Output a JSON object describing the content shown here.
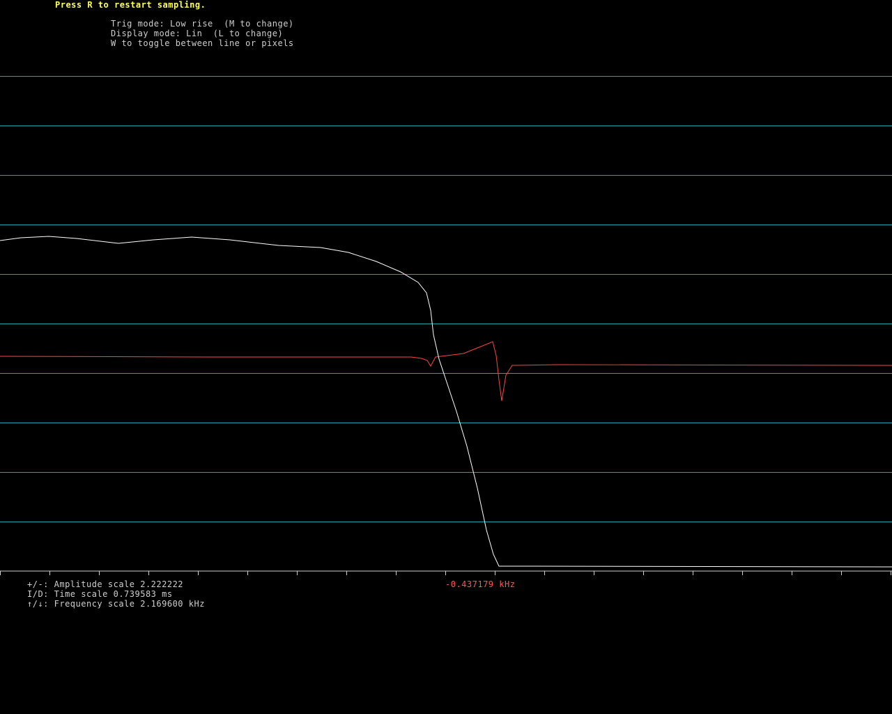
{
  "header": {
    "restart_hint": "Press R to restart sampling.",
    "trig_mode": "Trig mode: Low rise  (M to change)",
    "display_mode": "Display mode: Lin  (L to change)",
    "draw_toggle": "W to toggle between line or pixels"
  },
  "footer": {
    "amplitude": "+/-: Amplitude scale 2.222222",
    "time": "I/D: Time scale 0.739583 ms",
    "frequency": "↑/↓: Frequency scale 2.169600 kHz",
    "cursor_readout": "-0.437179 kHz"
  },
  "colors": {
    "grid": "#1fa6a6",
    "signal": "#ffffff",
    "spectrum": "#ff4444",
    "axis": "#d0d0d0"
  },
  "scope": {
    "gridlines": 10,
    "axis_ticks": 19,
    "signal_trace": [
      [
        0,
        345
      ],
      [
        30,
        341
      ],
      [
        70,
        339
      ],
      [
        110,
        342
      ],
      [
        170,
        349
      ],
      [
        220,
        344
      ],
      [
        275,
        340
      ],
      [
        330,
        344
      ],
      [
        400,
        352
      ],
      [
        460,
        355
      ],
      [
        500,
        362
      ],
      [
        540,
        375
      ],
      [
        575,
        390
      ],
      [
        600,
        405
      ],
      [
        612,
        420
      ],
      [
        618,
        445
      ],
      [
        622,
        480
      ],
      [
        630,
        515
      ],
      [
        640,
        545
      ],
      [
        655,
        590
      ],
      [
        670,
        640
      ],
      [
        685,
        700
      ],
      [
        698,
        760
      ],
      [
        708,
        795
      ],
      [
        716,
        812
      ],
      [
        730,
        812
      ],
      [
        760,
        812
      ],
      [
        1280,
        813
      ]
    ],
    "spectrum_trace": [
      [
        0,
        511
      ],
      [
        300,
        512
      ],
      [
        590,
        512
      ],
      [
        605,
        514
      ],
      [
        613,
        517
      ],
      [
        618,
        525
      ],
      [
        625,
        512
      ],
      [
        665,
        507
      ],
      [
        690,
        497
      ],
      [
        707,
        490
      ],
      [
        712,
        510
      ],
      [
        716,
        545
      ],
      [
        720,
        575
      ],
      [
        726,
        538
      ],
      [
        735,
        524
      ],
      [
        800,
        523
      ],
      [
        1280,
        524
      ]
    ]
  }
}
